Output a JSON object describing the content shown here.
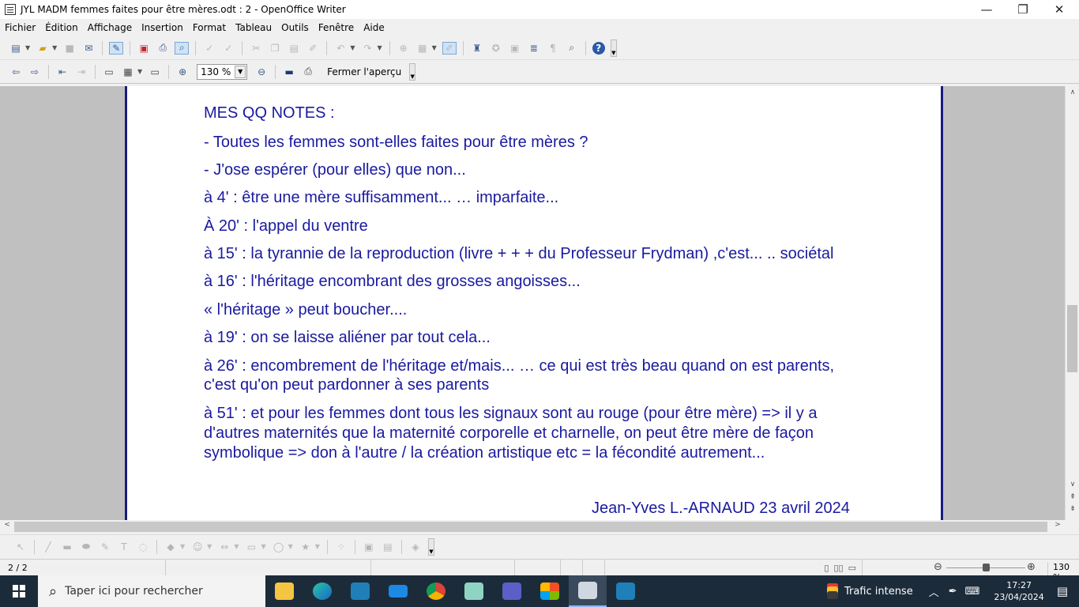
{
  "window": {
    "title": "JYL   MADM femmes faites pour être mères.odt : 2 - OpenOffice Writer",
    "minimize": "—",
    "maximize": "❐",
    "close": "✕"
  },
  "menu": [
    "Fichier",
    "Édition",
    "Affichage",
    "Insertion",
    "Format",
    "Tableau",
    "Outils",
    "Fenêtre",
    "Aide"
  ],
  "preview_toolbar": {
    "zoom_value": "130 %",
    "close_preview_label": "Fermer l'aperçu"
  },
  "document": {
    "lines": [
      "MES QQ NOTES :",
      "- Toutes les femmes sont-elles faites pour être mères ?",
      "- J'ose espérer (pour elles) que non...",
      "à 4' : être une mère suffisamment... … imparfaite...",
      "À 20' : l'appel du ventre",
      "à 15' : la tyrannie de la reproduction (livre + + + du Professeur Frydman) ,c'est... .. sociétal",
      "à 16' : l'héritage encombrant des grosses angoisses...",
      "« l'héritage » peut boucher....",
      "à 19' : on se laisse aliéner par tout cela...",
      "à 26' : encombrement de l'héritage et/mais... … ce qui est très beau quand on est parents,",
      "c'est qu'on peut pardonner à ses parents",
      "à 51' : et pour les femmes dont tous les signaux sont au rouge (pour être mère) => il y a",
      "d'autres maternités que la maternité corporelle et charnelle, on peut être mère de façon",
      "symbolique  =>  don à l'autre / la création artistique etc =  la fécondité autrement..."
    ],
    "signature": "Jean-Yves L.-ARNAUD    23 avril 2024"
  },
  "status": {
    "page": "2 / 2",
    "zoom": "130 %"
  },
  "taskbar": {
    "search_placeholder": "Taper ici pour rechercher",
    "weather": "Trafic intense",
    "time": "17:27",
    "date": "23/04/2024"
  }
}
